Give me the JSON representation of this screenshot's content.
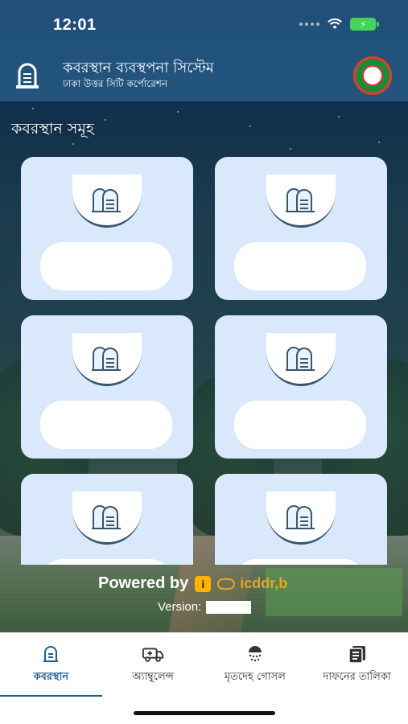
{
  "status": {
    "time": "12:01"
  },
  "header": {
    "title": "কবরস্থান ব্যবস্থপনা সিস্টেম",
    "subtitle": "ঢাকা উত্তর সিটি কর্পোরেশন",
    "logo_icon": "tombstone-icon",
    "seal_icon": "city-corporation-seal-icon"
  },
  "section": {
    "title": "কবরস্থান সমূহ"
  },
  "graveyards": [
    {
      "icon": "graveyard-icon",
      "name": ""
    },
    {
      "icon": "graveyard-icon",
      "name": ""
    },
    {
      "icon": "graveyard-icon",
      "name": ""
    },
    {
      "icon": "graveyard-icon",
      "name": ""
    },
    {
      "icon": "graveyard-icon",
      "name": ""
    },
    {
      "icon": "graveyard-icon",
      "name": ""
    }
  ],
  "footer": {
    "powered_by": "Powered by",
    "partner": "icddr,b",
    "version_label": "Version:",
    "version_value": ""
  },
  "nav": {
    "items": [
      {
        "label": "কবরস্থান",
        "icon": "tombstone-icon",
        "active": true
      },
      {
        "label": "অ্যাম্বুলেন্স",
        "icon": "ambulance-icon",
        "active": false
      },
      {
        "label": "মৃতদেহ গোসল",
        "icon": "shower-icon",
        "active": false
      },
      {
        "label": "দাফনের তালিকা",
        "icon": "list-icon",
        "active": false
      }
    ]
  },
  "colors": {
    "header_bg": "#23557f",
    "card_bg": "#d9e9fb",
    "active_nav": "#1f5f95",
    "accent_partner": "#e7a326"
  }
}
